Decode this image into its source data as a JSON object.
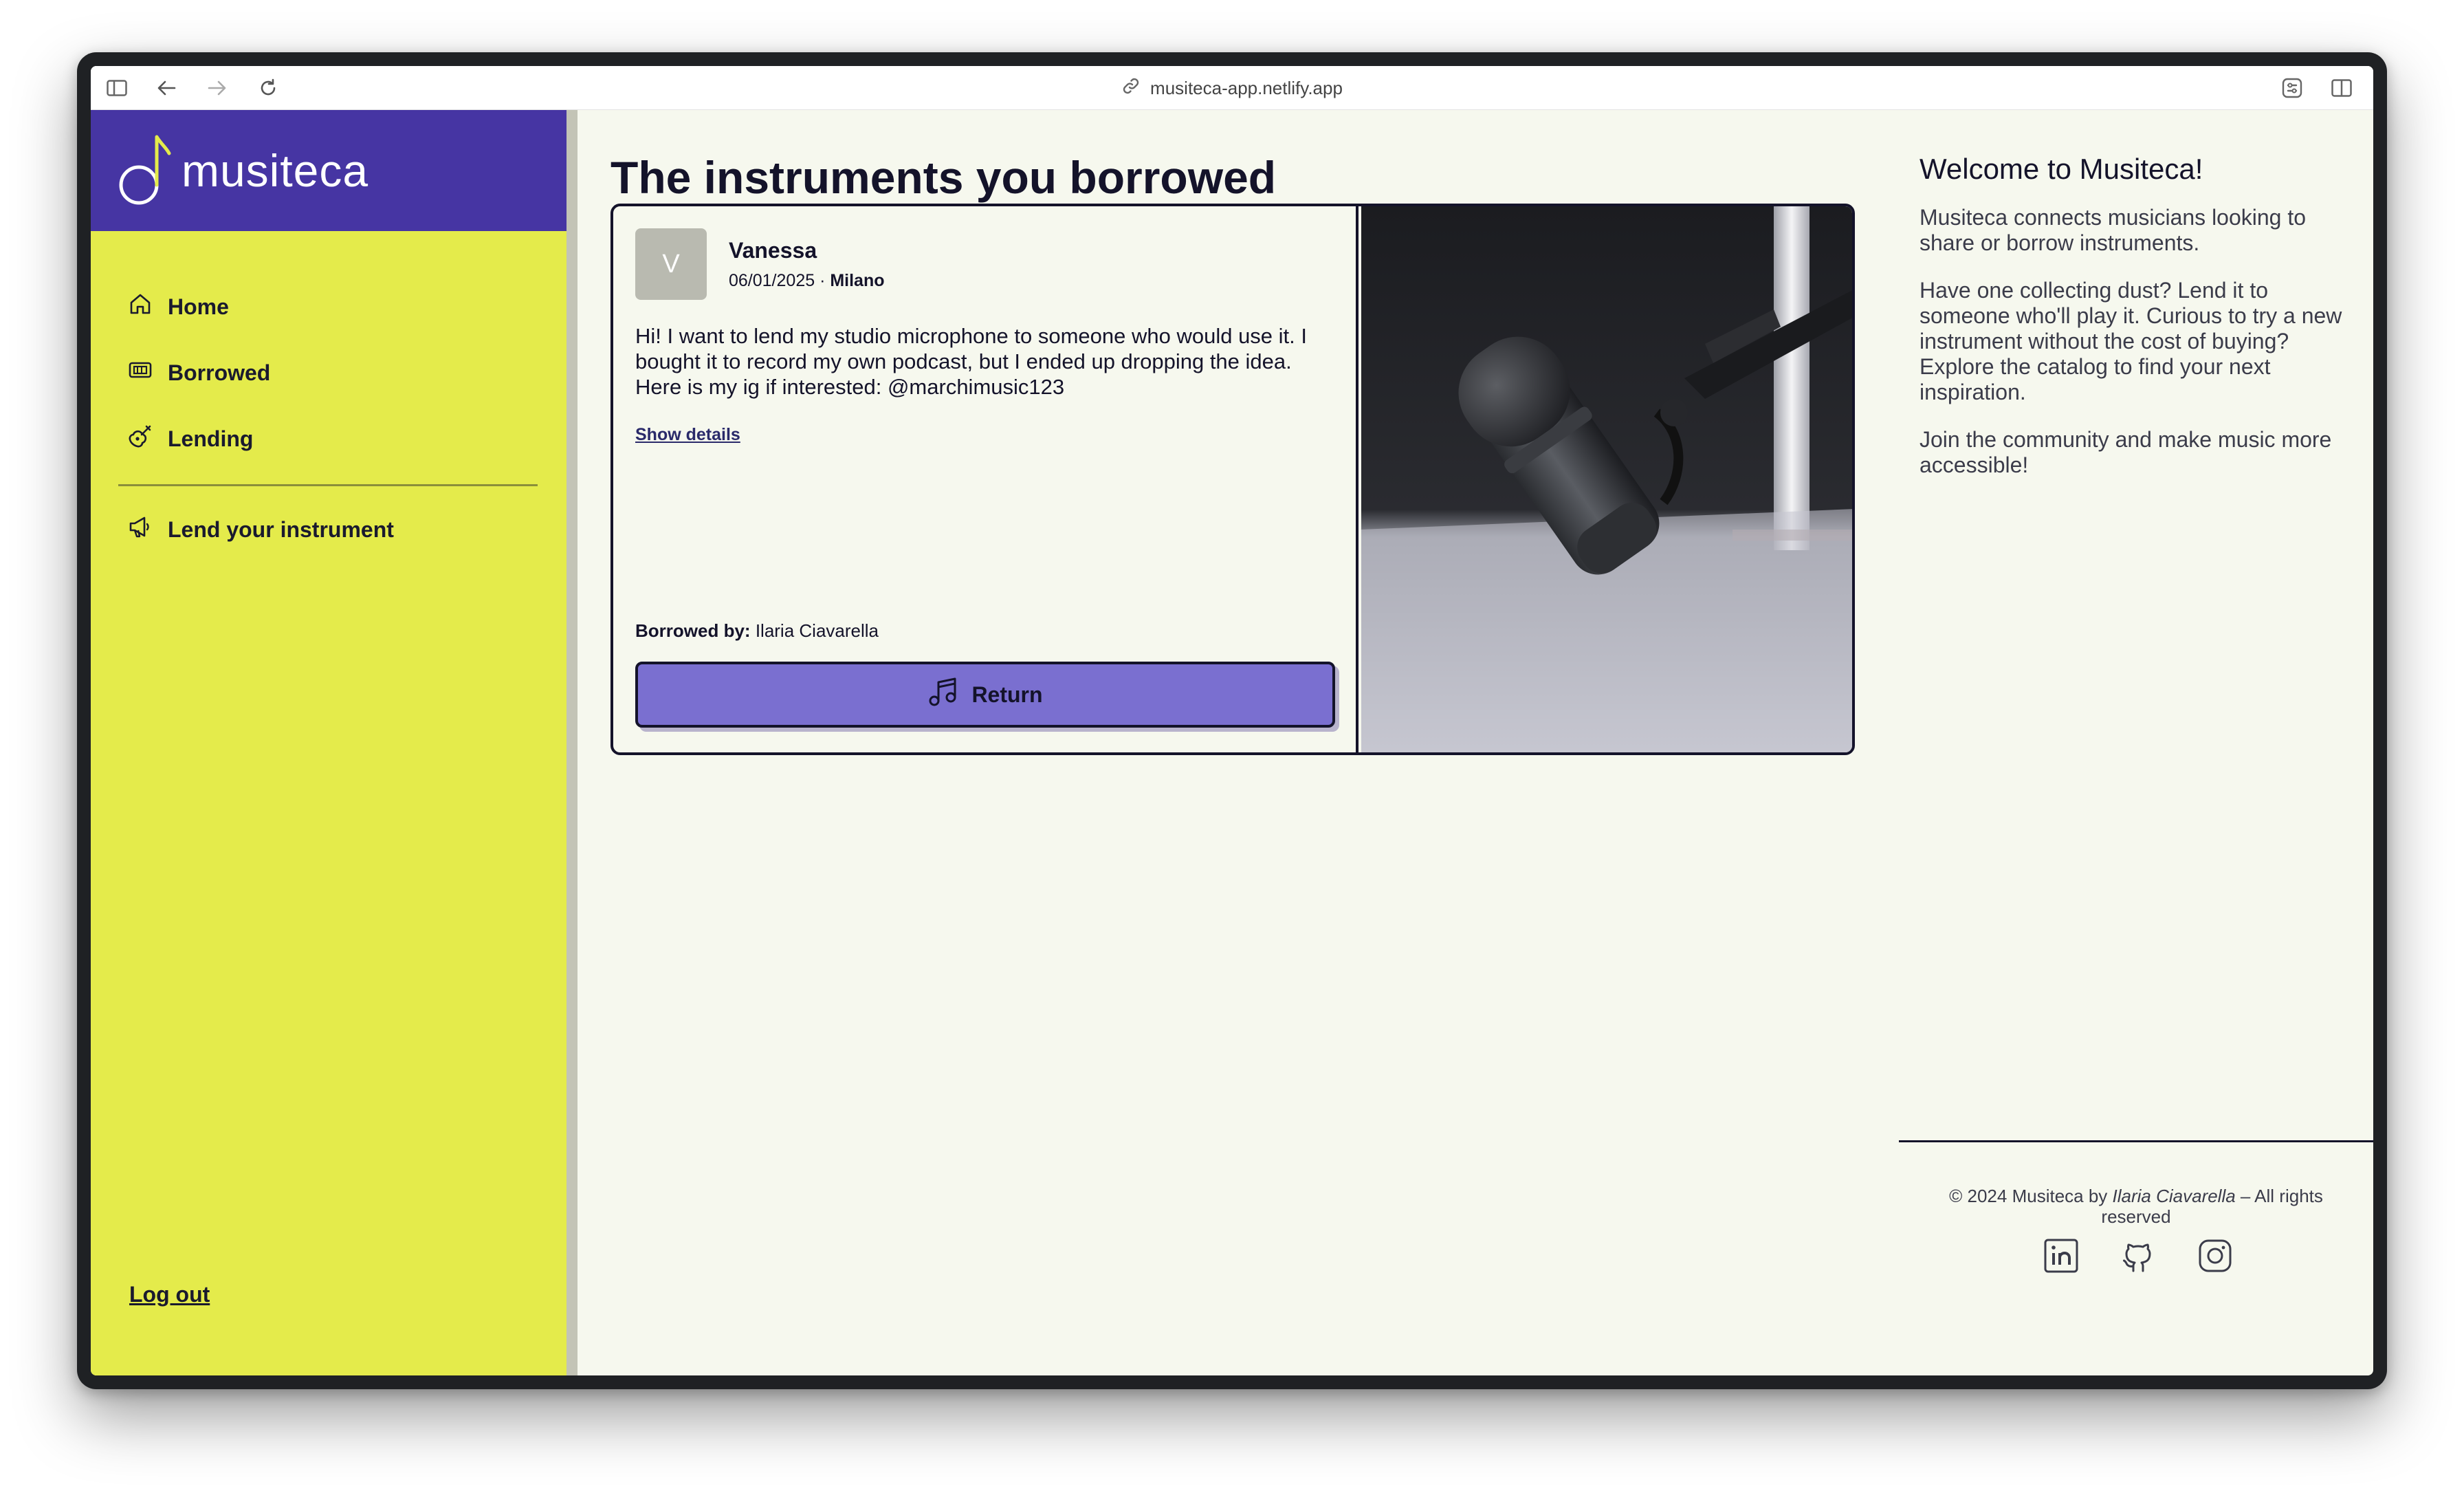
{
  "browser": {
    "url": "musiteca-app.netlify.app"
  },
  "brand": {
    "name": "musiteca",
    "logo_icon": "music-note-icon",
    "colors": {
      "primary": "#4635a3",
      "sidebar": "#e4eb4b",
      "accent": "#7a6fd0",
      "ink": "#14132a"
    }
  },
  "sidebar": {
    "items": [
      {
        "label": "Home",
        "icon": "home-icon"
      },
      {
        "label": "Borrowed",
        "icon": "ticket-icon"
      },
      {
        "label": "Lending",
        "icon": "guitar-icon"
      }
    ],
    "secondary": {
      "label": "Lend your instrument",
      "icon": "megaphone-icon"
    },
    "logout_label": "Log out"
  },
  "main": {
    "title": "The instruments you borrowed",
    "cards": [
      {
        "avatar_letter": "V",
        "owner": "Vanessa",
        "date": "06/01/2025",
        "separator": " · ",
        "city": "Milano",
        "description": "Hi! I want to lend my studio microphone to someone who would use it. I bought it to record my own podcast, but I ended up dropping the idea. Here is my ig if interested: @marchimusic123",
        "details_label": "Show details",
        "borrowed_by_label": "Borrowed by:",
        "borrowed_by_name": "Ilaria Ciavarella",
        "return_label": "Return",
        "photo": "studio-microphone-photo"
      }
    ]
  },
  "aside": {
    "title": "Welcome to Musiteca!",
    "paragraphs": [
      "Musiteca connects musicians looking to share or borrow instruments.",
      "Have one collecting dust? Lend it to someone who'll play it. Curious to try a new instrument without the cost of buying? Explore the catalog to find your next inspiration.",
      "Join the community and make music more accessible!"
    ]
  },
  "footer": {
    "copyright_prefix": "© 2024 Musiteca by ",
    "author": "Ilaria Ciavarella",
    "copyright_suffix": " – All rights reserved",
    "socials": [
      "linkedin-icon",
      "github-icon",
      "instagram-icon"
    ]
  }
}
